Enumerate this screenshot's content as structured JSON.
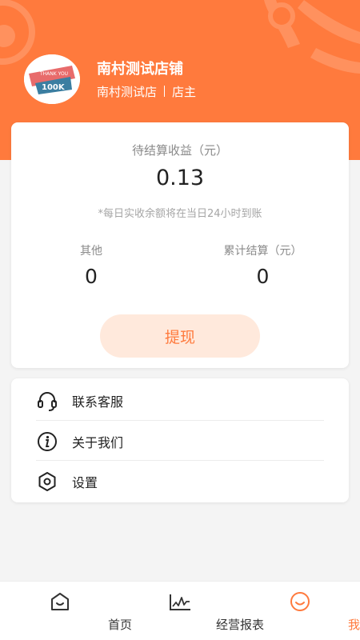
{
  "header": {
    "shop_name": "南村测试店铺",
    "shop_branch": "南村测试店",
    "role": "店主",
    "avatar_caption_top": "THANK YOU",
    "avatar_caption_main": "100K",
    "bg_color": "#ff7a3d"
  },
  "earnings": {
    "title": "待结算收益（元）",
    "value": "0.13",
    "note": "*每日实收余额将在当日24小时到账",
    "stats": [
      {
        "label": "其他",
        "value": "0"
      },
      {
        "label": "累计结算（元）",
        "value": "0"
      }
    ],
    "withdraw_label": "提现"
  },
  "menu": [
    {
      "label": "联系客服",
      "icon": "headset-icon"
    },
    {
      "label": "关于我们",
      "icon": "info-icon"
    },
    {
      "label": "设置",
      "icon": "settings-icon"
    }
  ],
  "tabs": [
    {
      "label": "首页",
      "icon": "home-icon",
      "active": false
    },
    {
      "label": "经营报表",
      "icon": "chart-icon",
      "active": false
    },
    {
      "label": "我的",
      "icon": "smile-icon",
      "active": true
    }
  ],
  "accent_color": "#ff7a3d"
}
